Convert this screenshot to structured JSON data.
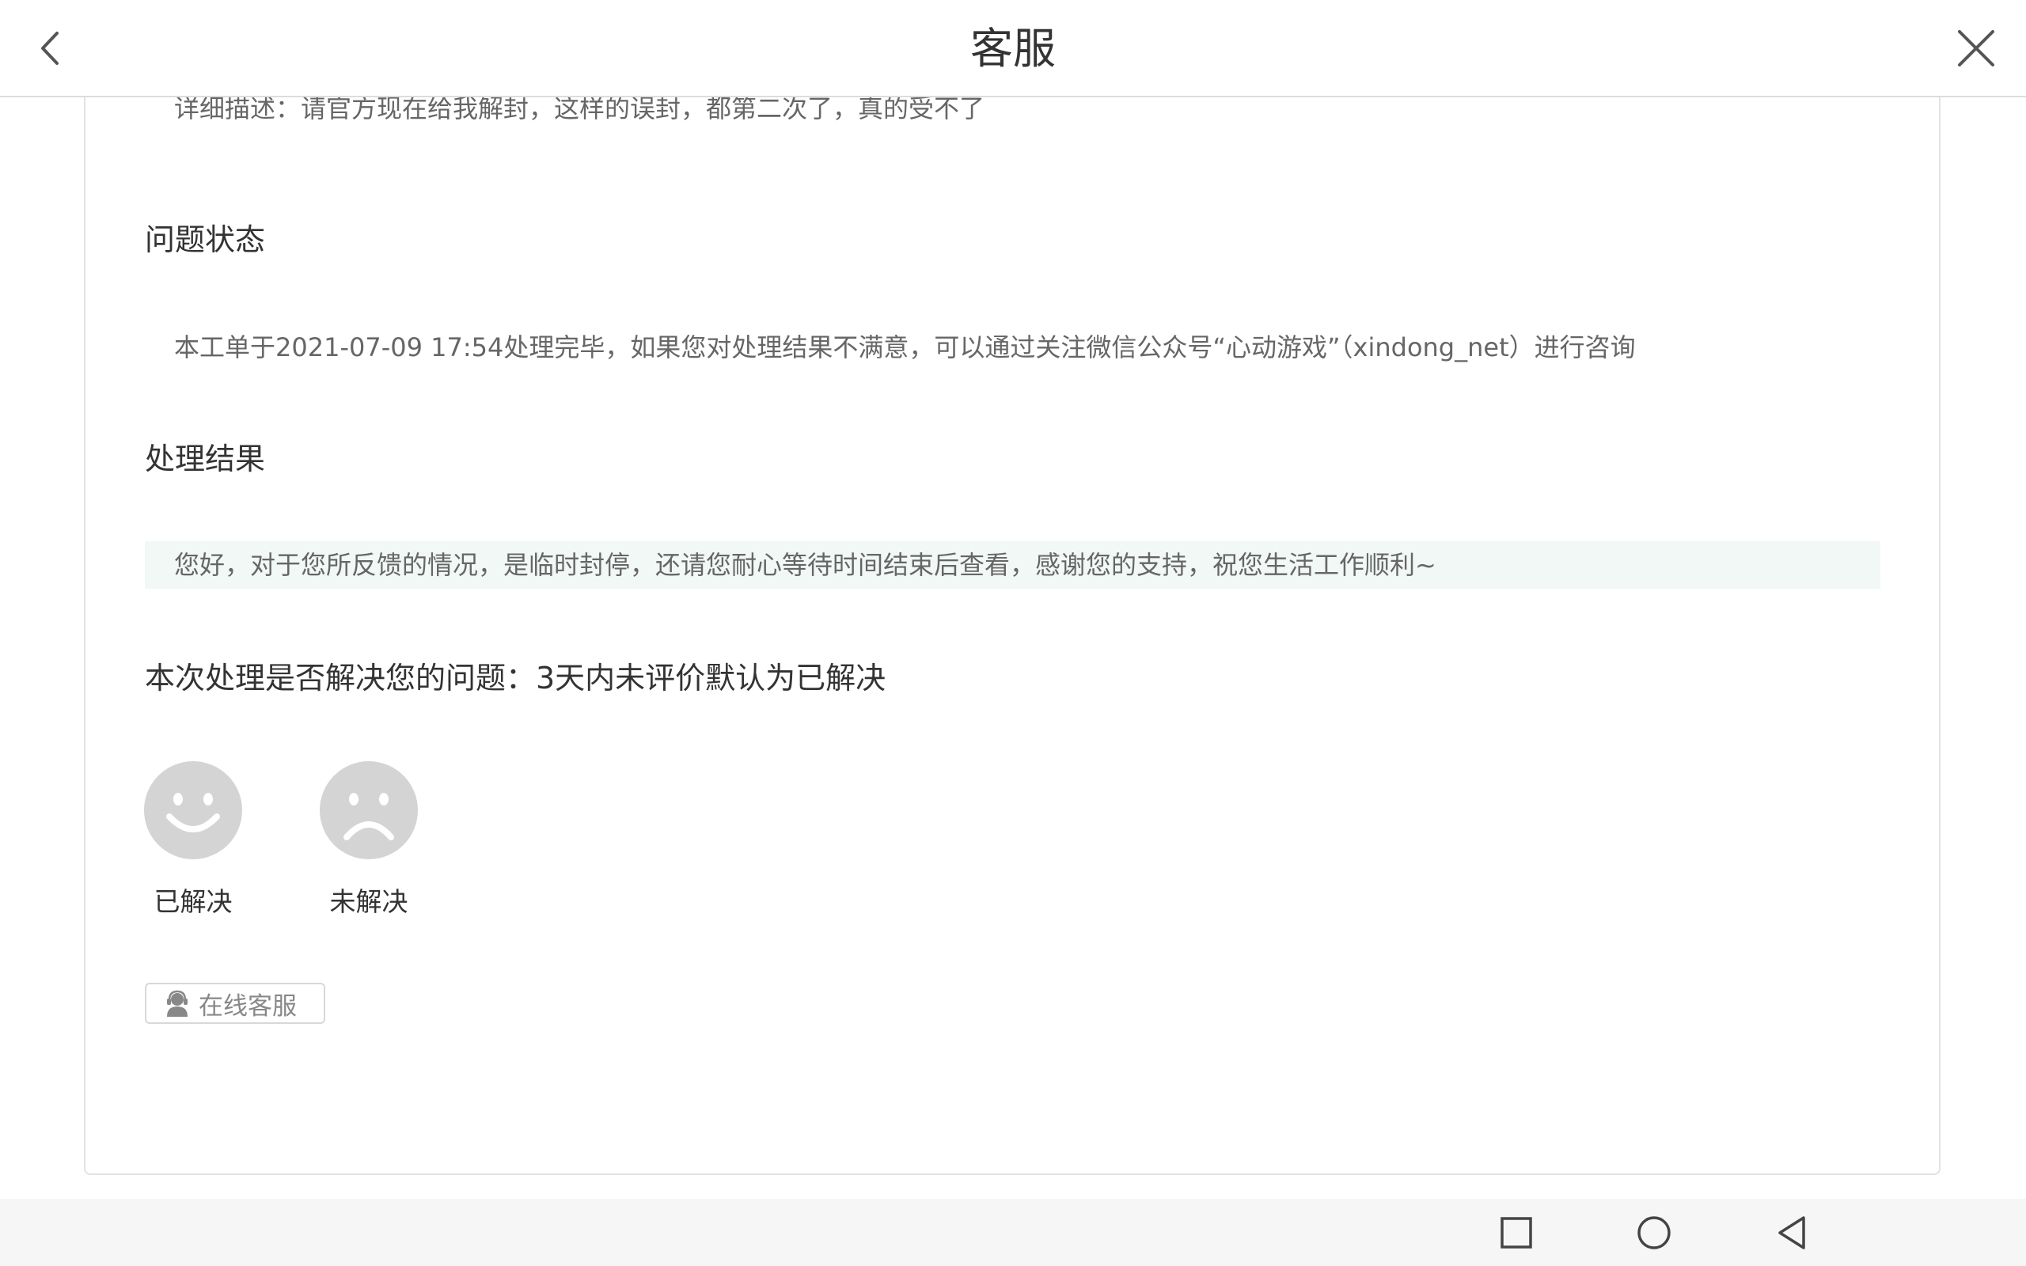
{
  "header": {
    "title": "客服",
    "back_icon": "chevron-left-icon",
    "close_icon": "close-icon"
  },
  "ticket": {
    "description_line": "详细描述：请官方现在给我解封，这样的误封，都第二次了，真的受不了",
    "status_title": "问题状态",
    "status_text": "本工单于2021-07-09 17:54处理完毕，如果您对处理结果不满意，可以通过关注微信公众号“心动游戏”（xindong_net）进行咨询",
    "result_title": "处理结果",
    "result_text": "您好，对于您所反馈的情况，是临时封停，还请您耐心等待时间结束后查看，感谢您的支持，祝您生活工作顺利~",
    "result_bg_color": "#f1f8f5"
  },
  "feedback": {
    "question": "本次处理是否解决您的问题：3天内未评价默认为已解决",
    "resolved_label": "已解决",
    "unresolved_label": "未解决",
    "face_color": "#d4d4d4"
  },
  "online_service": {
    "label": "在线客服",
    "icon": "customer-service-icon"
  },
  "navbar": {
    "icons": [
      "recent-apps-icon",
      "home-icon",
      "back-triangle-icon"
    ]
  }
}
